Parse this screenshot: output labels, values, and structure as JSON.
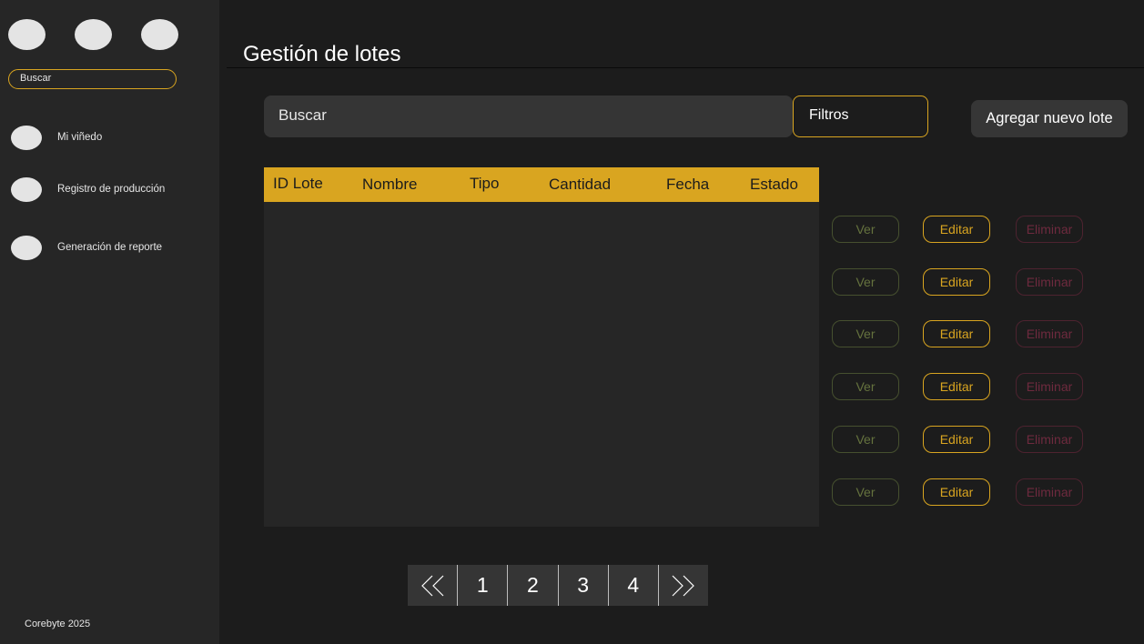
{
  "sidebar": {
    "search_placeholder": "Buscar",
    "items": [
      {
        "label": "Mi viñedo"
      },
      {
        "label": "Registro de producción"
      },
      {
        "label": "Generación de reporte"
      }
    ],
    "footer": "Corebyte 2025"
  },
  "page": {
    "title": "Gestión de lotes",
    "search_placeholder": "Buscar",
    "filters_label": "Filtros",
    "add_label": "Agregar nuevo lote"
  },
  "table": {
    "columns": [
      "ID Lote",
      "Nombre",
      "Tipo",
      "Cantidad",
      "Fecha",
      "Estado"
    ],
    "row_actions": {
      "view": "Ver",
      "edit": "Editar",
      "delete": "Eliminar"
    }
  },
  "pagination": {
    "prev_icon": "double-chevron-left",
    "pages": [
      "1",
      "2",
      "3",
      "4"
    ],
    "next_icon": "double-chevron-right"
  },
  "colors": {
    "accent": "#d9a520",
    "view": "#65723e",
    "delete": "#6e2a3e",
    "background": "#1c1c1c",
    "sidebar": "#262626"
  }
}
